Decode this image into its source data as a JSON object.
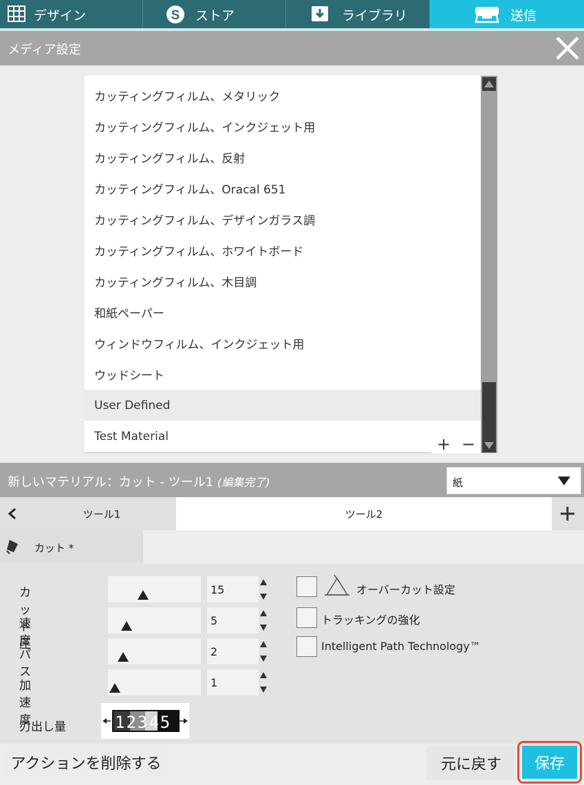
{
  "nav": {
    "tabs": [
      {
        "label": "デザイン",
        "icon": "grid-icon"
      },
      {
        "label": "ストア",
        "icon": "store-s-icon"
      },
      {
        "label": "ライブラリ",
        "icon": "download-icon"
      },
      {
        "label": "送信",
        "icon": "plotter-icon"
      }
    ],
    "active": "送信"
  },
  "header": {
    "title": "メディア設定"
  },
  "media_list": {
    "items": [
      "カッティングフィルム、メタリック",
      "カッティングフィルム、インクジェット用",
      "カッティングフィルム、反射",
      "カッティングフィルム、Oracal 651",
      "カッティングフィルム、デザインガラス調",
      "カッティングフィルム、ホワイトボード",
      "カッティングフィルム、木目調",
      "和紙ペーパー",
      "ウィンドウフィルム、インクジェット用",
      "ウッドシート",
      "User Defined",
      "Test Material"
    ],
    "selected": "User Defined",
    "add_label": "+",
    "remove_label": "−"
  },
  "material": {
    "title": "新しいマテリアル：カット - ツール1",
    "status": "(編集完了)",
    "type_value": "紙"
  },
  "tools": {
    "tab1": "ツール1",
    "tab2": "ツール2",
    "active": "ツール2"
  },
  "action": {
    "label": "カット *"
  },
  "settings": {
    "sliders": [
      {
        "label": "カット圧",
        "value": "15",
        "level": 0.36
      },
      {
        "label": "速度",
        "value": "5",
        "level": 0.16
      },
      {
        "label": "パス",
        "value": "2",
        "level": 0.12
      },
      {
        "label": "加速度",
        "value": "1",
        "level": 0.02
      }
    ],
    "checkboxes": [
      {
        "label": "オーバーカット設定",
        "checked": false
      },
      {
        "label": "トラッキングの強化",
        "checked": false
      },
      {
        "label": "Intelligent Path Technology™",
        "checked": false
      }
    ],
    "blade_label": "刃出し量",
    "blade_digits": "12345"
  },
  "buttons": {
    "delete_action": "アクションを削除する",
    "undo": "元に戻す",
    "save": "保存"
  },
  "colors": {
    "nav_bg": "#2c6b73",
    "accent": "#1fc0de",
    "highlight": "#e24b3b"
  }
}
